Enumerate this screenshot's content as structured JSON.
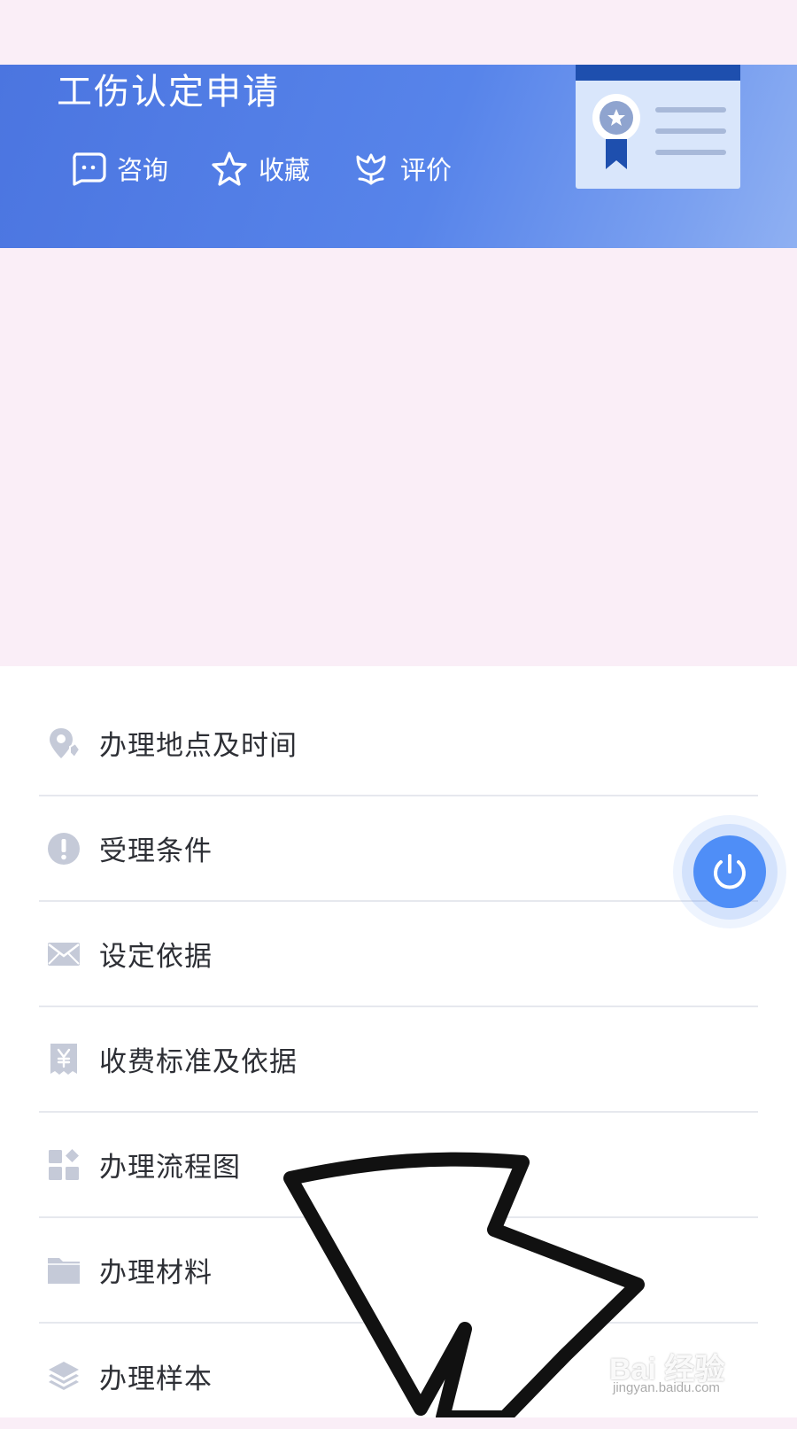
{
  "header": {
    "title": "工伤认定申请",
    "actions": [
      {
        "label": "咨询",
        "icon": "chat-bubble-icon"
      },
      {
        "label": "收藏",
        "icon": "star-icon"
      },
      {
        "label": "评价",
        "icon": "flower-icon"
      }
    ],
    "illustration": "certificate-icon"
  },
  "menu": {
    "items": [
      {
        "label": "办理地点及时间",
        "icon": "location-pin-icon"
      },
      {
        "label": "受理条件",
        "icon": "exclamation-icon"
      },
      {
        "label": "设定依据",
        "icon": "envelope-icon"
      },
      {
        "label": "收费标准及依据",
        "icon": "yuan-receipt-icon"
      },
      {
        "label": "办理流程图",
        "icon": "flowchart-grid-icon"
      },
      {
        "label": "办理材料",
        "icon": "folder-icon"
      },
      {
        "label": "办理样本",
        "icon": "layers-icon"
      }
    ]
  },
  "floating_button": {
    "icon": "power-icon",
    "color": "#4f8ef7"
  },
  "watermark": {
    "main": "Bai 经验",
    "sub": "jingyan.baidu.com"
  },
  "colors": {
    "header_blue": "#4b75e0",
    "page_bg": "#faeef7",
    "icon_gray": "#c5cad8",
    "text_dark": "#2d2f35"
  }
}
